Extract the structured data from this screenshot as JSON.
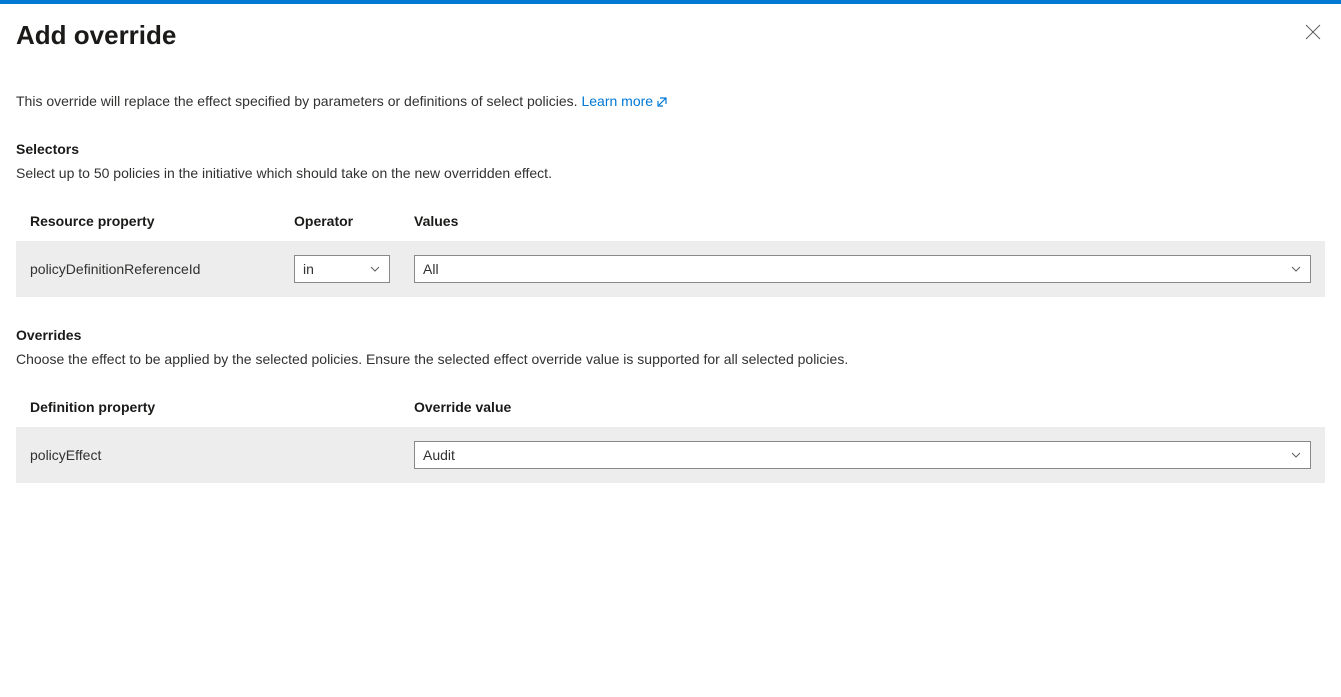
{
  "header": {
    "title": "Add override"
  },
  "description": {
    "text": "This override will replace the effect specified by parameters or definitions of select policies. ",
    "learn_more": "Learn more"
  },
  "selectors": {
    "heading": "Selectors",
    "desc": "Select up to 50 policies in the initiative which should take on the new overridden effect.",
    "columns": {
      "resource_property": "Resource property",
      "operator": "Operator",
      "values": "Values"
    },
    "row": {
      "resource_property": "policyDefinitionReferenceId",
      "operator": "in",
      "values": "All"
    }
  },
  "overrides": {
    "heading": "Overrides",
    "desc": "Choose the effect to be applied by the selected policies. Ensure the selected effect override value is supported for all selected policies.",
    "columns": {
      "definition_property": "Definition property",
      "override_value": "Override value"
    },
    "row": {
      "definition_property": "policyEffect",
      "override_value": "Audit"
    }
  }
}
